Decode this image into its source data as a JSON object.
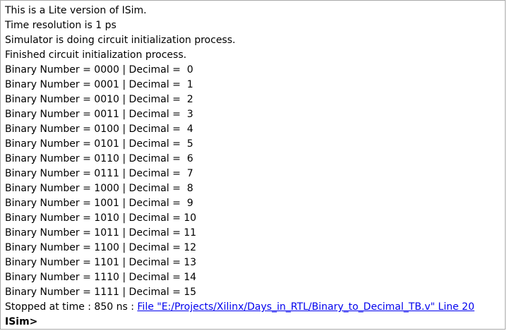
{
  "console": {
    "header_lines": [
      "This is a Lite version of ISim.",
      "Time resolution is 1 ps",
      "Simulator is doing circuit initialization process.",
      "Finished circuit initialization process."
    ],
    "output_lines": [
      "Binary Number = 0000 | Decimal =  0",
      "Binary Number = 0001 | Decimal =  1",
      "Binary Number = 0010 | Decimal =  2",
      "Binary Number = 0011 | Decimal =  3",
      "Binary Number = 0100 | Decimal =  4",
      "Binary Number = 0101 | Decimal =  5",
      "Binary Number = 0110 | Decimal =  6",
      "Binary Number = 0111 | Decimal =  7",
      "Binary Number = 1000 | Decimal =  8",
      "Binary Number = 1001 | Decimal =  9",
      "Binary Number = 1010 | Decimal = 10",
      "Binary Number = 1011 | Decimal = 11",
      "Binary Number = 1100 | Decimal = 12",
      "Binary Number = 1101 | Decimal = 13",
      "Binary Number = 1110 | Decimal = 14",
      "Binary Number = 1111 | Decimal = 15"
    ],
    "stopped": {
      "prefix": "Stopped at time : 850 ns : ",
      "link_text": "File \"E:/Projects/Xilinx/Days_in_RTL/Binary_to_Decimal_TB.v\" Line 20"
    },
    "prompt": "ISim>"
  },
  "colors": {
    "link": "#0000ee",
    "border": "#a9a9a9",
    "background": "#ffffff"
  }
}
